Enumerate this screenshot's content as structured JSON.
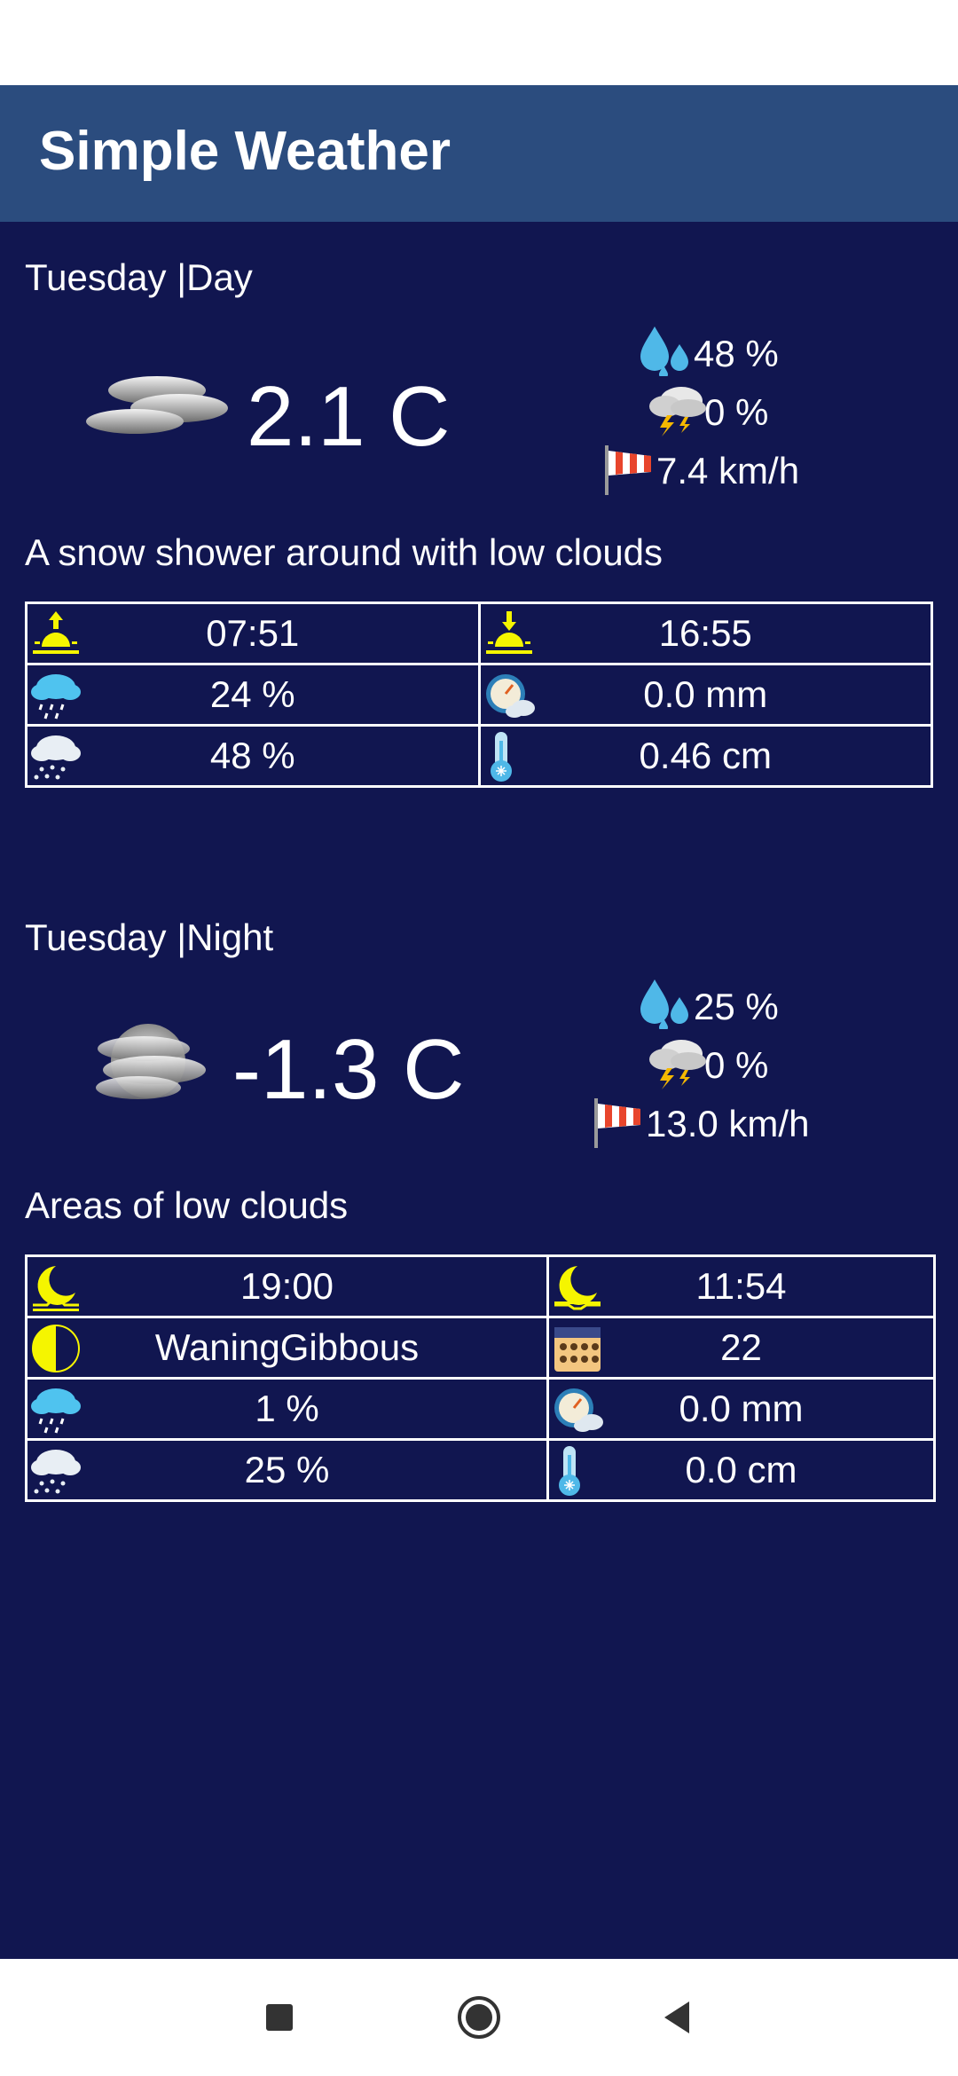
{
  "app": {
    "title": "Simple Weather"
  },
  "day": {
    "label": "Tuesday |Day",
    "temperature": "2.1 C",
    "humidity": "48 %",
    "thunder": "0 %",
    "wind": "7.4 km/h",
    "description": "A snow shower around with low clouds",
    "icon": "cloudy-icon",
    "rows": [
      [
        {
          "icon": "sunrise-icon",
          "value": "07:51"
        },
        {
          "icon": "sunset-icon",
          "value": "16:55"
        }
      ],
      [
        {
          "icon": "rain-chance-icon",
          "value": "24 %"
        },
        {
          "icon": "precipitation-gauge-icon",
          "value": "0.0 mm"
        }
      ],
      [
        {
          "icon": "snow-chance-icon",
          "value": "48 %"
        },
        {
          "icon": "snow-thermometer-icon",
          "value": "0.46 cm"
        }
      ]
    ]
  },
  "night": {
    "label": "Tuesday |Night",
    "temperature": "-1.3 C",
    "humidity": "25 %",
    "thunder": "0 %",
    "wind": "13.0 km/h",
    "description": "Areas of low clouds",
    "icon": "cloudy-moon-icon",
    "rows": [
      [
        {
          "icon": "moonrise-icon",
          "value": "19:00"
        },
        {
          "icon": "moonset-icon",
          "value": "11:54"
        }
      ],
      [
        {
          "icon": "moon-phase-icon",
          "value": "WaningGibbous"
        },
        {
          "icon": "moon-age-calendar-icon",
          "value": "22"
        }
      ],
      [
        {
          "icon": "rain-chance-icon",
          "value": "1 %"
        },
        {
          "icon": "precipitation-gauge-icon",
          "value": "0.0 mm"
        }
      ],
      [
        {
          "icon": "snow-chance-icon",
          "value": "25 %"
        },
        {
          "icon": "snow-thermometer-icon",
          "value": "0.0 cm"
        }
      ]
    ]
  },
  "colors": {
    "appbar": "#2b4c7e",
    "background": "#111650",
    "accent_yellow": "#f5f500",
    "water_blue": "#4fb8e8"
  }
}
